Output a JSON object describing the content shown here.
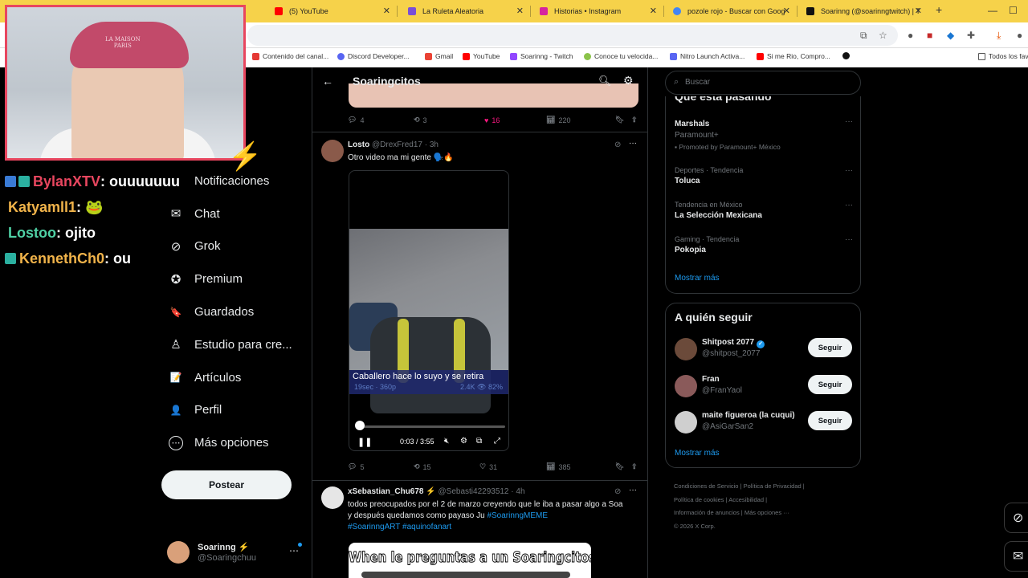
{
  "browser": {
    "tabs": [
      {
        "label": "(5) YouTube",
        "color": "#ff0000"
      },
      {
        "label": "La Ruleta Aleatoria",
        "color": "#7a4fd6"
      },
      {
        "label": "Historias • Instagram",
        "color": "#d6249f"
      },
      {
        "label": "pozole rojo - Buscar con Goog",
        "color": "#4285f4"
      },
      {
        "label": "Soarinng (@soarinngtwitch) | T",
        "color": "#111111"
      }
    ],
    "new_tab": "+",
    "bookmarks": [
      {
        "label": "Contenido del canal...",
        "color": "#e53935"
      },
      {
        "label": "Discord Developer...",
        "color": "#5865f2"
      },
      {
        "label": "Gmail",
        "color": "#ea4335"
      },
      {
        "label": "YouTube",
        "color": "#ff0000"
      },
      {
        "label": "Soarinng - Twitch",
        "color": "#9146ff"
      },
      {
        "label": "Conoce tu velocida...",
        "color": "#8bc34a"
      },
      {
        "label": "Nitro Launch Activa...",
        "color": "#5865f2"
      },
      {
        "label": "Si me Rio, Compro...",
        "color": "#ff0000"
      },
      {
        "label": "",
        "color": "#111111"
      }
    ],
    "all_bookmarks": "Todos los fav"
  },
  "stream": {
    "cap_text": "LA MAISON\nPARIS",
    "chat": [
      {
        "user": "BylanXTV",
        "color": "#e8465f",
        "msg": " : ouuuuuuu",
        "badges": 2
      },
      {
        "user": "Katyamll1",
        "color": "#f0b34a",
        "msg": " : 🐸",
        "badges": 0
      },
      {
        "user": "Lostoo",
        "color": "#4fd1a5",
        "msg": " : ojito",
        "badges": 0
      },
      {
        "user": "KennethCh0",
        "color": "#f0b34a",
        "msg": " : ou",
        "badges": 1
      }
    ]
  },
  "nav": {
    "items": [
      {
        "label": "Notificaciones",
        "icon": "bell-icon",
        "glyph": "🔔"
      },
      {
        "label": "Chat",
        "icon": "mail-icon",
        "glyph": "✉"
      },
      {
        "label": "Grok",
        "icon": "grok-icon",
        "glyph": "⊘"
      },
      {
        "label": "Premium",
        "icon": "premium-icon",
        "glyph": "✪"
      },
      {
        "label": "Guardados",
        "icon": "bookmark-icon",
        "glyph": "🔖"
      },
      {
        "label": "Estudio para cre...",
        "icon": "studio-icon",
        "glyph": "♙"
      },
      {
        "label": "Artículos",
        "icon": "articles-icon",
        "glyph": "📝"
      },
      {
        "label": "Perfil",
        "icon": "profile-icon",
        "glyph": "👤"
      },
      {
        "label": "Más opciones",
        "icon": "more-options-icon",
        "glyph": "⋯"
      }
    ],
    "post_button": "Postear",
    "account": {
      "name": "Soarinng ⚡",
      "handle": "@Soaringchuu",
      "more": "⋯"
    }
  },
  "feed": {
    "title": "Soaringcitos",
    "prev_actions": {
      "replies": "4",
      "reposts": "3",
      "likes": "16",
      "views": "220"
    },
    "tweet1": {
      "name": "Losto",
      "handle": "@DrexFred17",
      "time": "3h",
      "text": "Otro video ma mi gente 🗣️🔥",
      "video": {
        "caption": "Caballero hace lo suyo y se retira",
        "caption_meta": "19sec · 360p",
        "caption_stats": "2.4K 👁 82%",
        "time": "0:03 / 3:55",
        "progress": 0.014
      },
      "actions": {
        "replies": "5",
        "reposts": "15",
        "likes": "31",
        "views": "385"
      }
    },
    "tweet2": {
      "name": "xSebastian_Chu678 ⚡",
      "handle": "@Sebasti42293512",
      "time": "4h",
      "text": "todos preocupados por el 2 de marzo creyendo que le iba a pasar algo a Soa  y después quedamos como payaso Ju ",
      "hashtags_1": "#SoarinngMEME",
      "hashtags_2": "#SoarinngART #aquinofanart",
      "meme_caption": "When le preguntas a un Soaringcitos y un chato,"
    }
  },
  "right": {
    "search_placeholder": "Buscar",
    "trends_title": "Qué está pasando",
    "trends": [
      {
        "context": "",
        "name": "Marshals",
        "sub": "Paramount+",
        "promo": "Promoted by Paramount+ México"
      },
      {
        "context": "Deportes · Tendencia",
        "name": "Toluca",
        "sub": "",
        "promo": ""
      },
      {
        "context": "Tendencia en México",
        "name": "La Selección Mexicana",
        "sub": "",
        "promo": ""
      },
      {
        "context": "Gaming · Tendencia",
        "name": "Pokopia",
        "sub": "",
        "promo": ""
      }
    ],
    "show_more": "Mostrar más",
    "follow_title": "A quién seguir",
    "follow": [
      {
        "name": "Shitpost 2077",
        "handle": "@shitpost_2077",
        "button": "Seguir",
        "verified": true,
        "color": "#6b4a3a"
      },
      {
        "name": "Fran",
        "handle": "@FranYaol",
        "button": "Seguir",
        "verified": false,
        "color": "#8a5a5a"
      },
      {
        "name": "maite figueroa (la cuqui)",
        "handle": "@AsiGarSan2",
        "button": "Seguir",
        "verified": false,
        "color": "#cfcfcf"
      }
    ],
    "follow_more": "Mostrar más",
    "footer": [
      "Condiciones de Servicio  |   Política de Privacidad  |",
      "Política de cookies  |   Accesibilidad  |",
      "Información de anuncios  |   Más opciones ···",
      "© 2026 X Corp."
    ]
  }
}
